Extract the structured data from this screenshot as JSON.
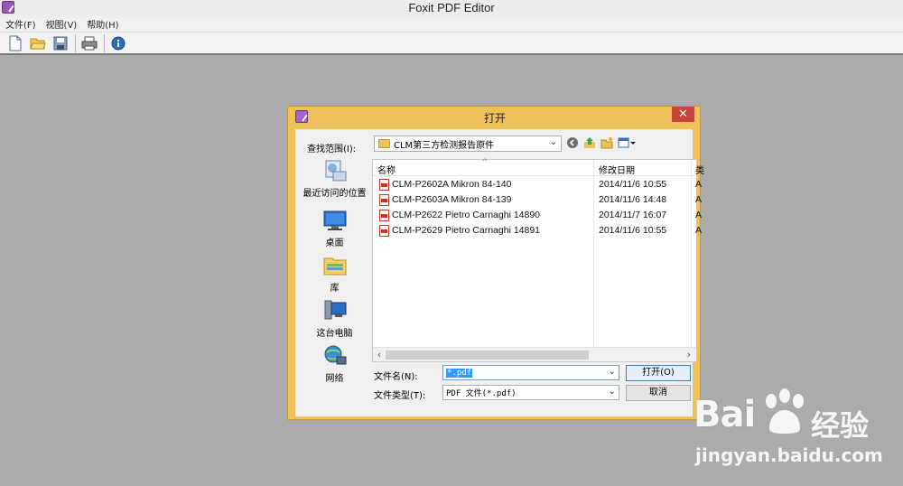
{
  "app": {
    "title": "Foxit PDF Editor",
    "menu": [
      "文件(F)",
      "视图(V)",
      "帮助(H)"
    ],
    "toolbar": {
      "icons": [
        "new-document-icon",
        "open-folder-icon",
        "save-icon",
        "print-icon",
        "info-icon"
      ]
    }
  },
  "dialog": {
    "title": "打开",
    "close_glyph": "✕",
    "lookin_label": "查找范围(I):",
    "lookin_value": "CLM第三方检测报告原件",
    "places": [
      {
        "label": "最近访问的位置",
        "icon": "recent-places-icon"
      },
      {
        "label": "桌面",
        "icon": "desktop-icon"
      },
      {
        "label": "库",
        "icon": "libraries-icon"
      },
      {
        "label": "这台电脑",
        "icon": "this-pc-icon"
      },
      {
        "label": "网络",
        "icon": "network-icon"
      }
    ],
    "columns": {
      "name": "名称",
      "date": "修改日期",
      "more": "类"
    },
    "files": [
      {
        "name": "CLM-P2602A Mikron 84-140",
        "date": "2014/11/6 10:55",
        "extra": "A"
      },
      {
        "name": "CLM-P2603A Mikron 84-139",
        "date": "2014/11/6 14:48",
        "extra": "A"
      },
      {
        "name": "CLM-P2622 Pietro Carnaghi 14890",
        "date": "2014/11/7 16:07",
        "extra": "A"
      },
      {
        "name": "CLM-P2629 Pietro Carnaghi 14891",
        "date": "2014/11/6 10:55",
        "extra": "A"
      }
    ],
    "filename_label": "文件名(N):",
    "filename_value": "*.pdf",
    "filetype_label": "文件类型(T):",
    "filetype_value": "PDF 文件(*.pdf)",
    "open_button": "打开(O)",
    "cancel_button": "取消"
  },
  "watermark": {
    "brand": "Bai",
    "brand_cn": "经验",
    "url": "jingyan.baidu.com"
  },
  "colors": {
    "dialog_frame": "#f0c15a",
    "close_button": "#c7443a",
    "workspace": "#ababab",
    "selection": "#3399ff"
  }
}
